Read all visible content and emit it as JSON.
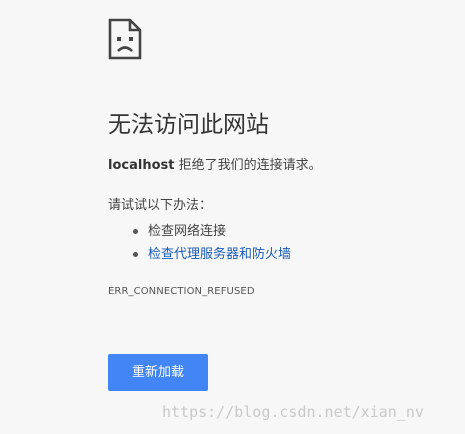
{
  "icon": "sad-page-icon",
  "headline": "无法访问此网站",
  "summary": {
    "host": "localhost",
    "message": " 拒绝了我们的连接请求。"
  },
  "suggestions": {
    "title": "请试试以下办法：",
    "items": [
      {
        "label": "检查网络连接",
        "is_link": false
      },
      {
        "label": "检查代理服务器和防火墙",
        "is_link": true
      }
    ]
  },
  "error_code": "ERR_CONNECTION_REFUSED",
  "reload_button_label": "重新加载",
  "watermark": "https://blog.csdn.net/xian_nv",
  "colors": {
    "background": "#f7f7f7",
    "button": "#4285f4",
    "link": "#1a5bb8"
  }
}
